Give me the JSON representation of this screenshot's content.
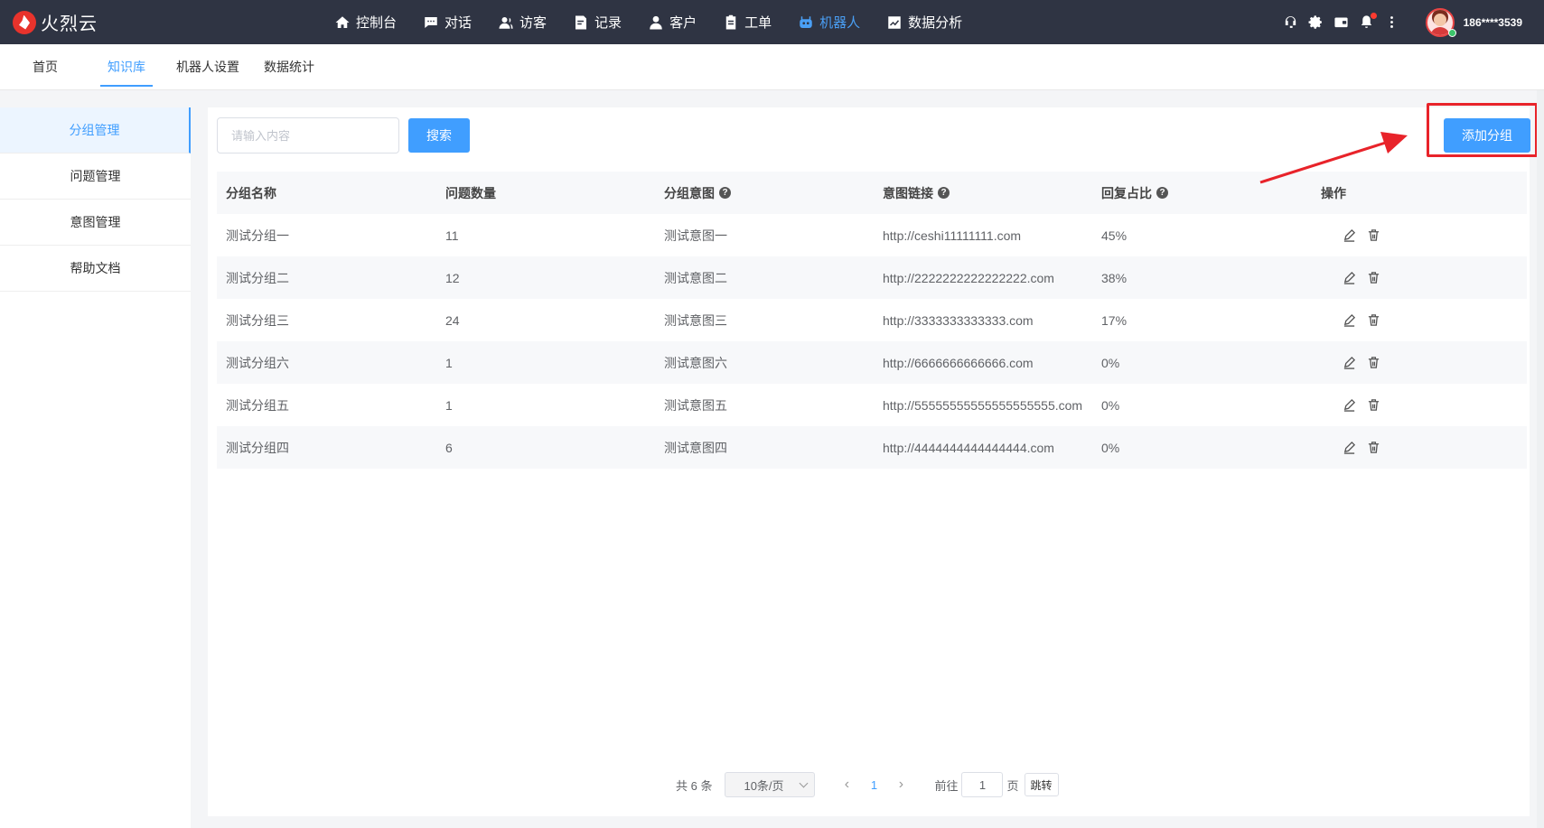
{
  "app": {
    "logo_text": "火烈云",
    "brand_color": "#e8332c",
    "accent_color": "#409eff",
    "topbar_color": "#2f3443"
  },
  "nav": {
    "items": [
      {
        "label": "控制台",
        "icon": "home-icon"
      },
      {
        "label": "对话",
        "icon": "chat-icon"
      },
      {
        "label": "访客",
        "icon": "visitor-icon"
      },
      {
        "label": "记录",
        "icon": "record-icon"
      },
      {
        "label": "客户",
        "icon": "customer-icon"
      },
      {
        "label": "工单",
        "icon": "ticket-icon"
      },
      {
        "label": "机器人",
        "icon": "robot-icon",
        "active": true
      },
      {
        "label": "数据分析",
        "icon": "chart-icon"
      }
    ]
  },
  "user": {
    "name": "186****3539",
    "status": "online"
  },
  "subtabs": [
    {
      "label": "首页"
    },
    {
      "label": "知识库",
      "active": true
    },
    {
      "label": "机器人设置"
    },
    {
      "label": "数据统计"
    }
  ],
  "sidebar": {
    "items": [
      {
        "label": "分组管理",
        "active": true
      },
      {
        "label": "问题管理"
      },
      {
        "label": "意图管理"
      },
      {
        "label": "帮助文档"
      }
    ]
  },
  "toolbar": {
    "search_placeholder": "请输入内容",
    "search_label": "搜索",
    "add_label": "添加分组"
  },
  "table": {
    "headers": [
      "分组名称",
      "问题数量",
      "分组意图",
      "意图链接",
      "回复占比",
      "操作"
    ],
    "rows": [
      [
        "测试分组一",
        "11",
        "测试意图一",
        "http://ceshi11111111.com",
        "45%"
      ],
      [
        "测试分组二",
        "12",
        "测试意图二",
        "http://2222222222222222.com",
        "38%"
      ],
      [
        "测试分组三",
        "24",
        "测试意图三",
        "http://3333333333333.com",
        "17%"
      ],
      [
        "测试分组六",
        "1",
        "测试意图六",
        "http://6666666666666.com",
        "0%"
      ],
      [
        "测试分组五",
        "1",
        "测试意图五",
        "http://55555555555555555555.com",
        "0%"
      ],
      [
        "测试分组四",
        "6",
        "测试意图四",
        "http://4444444444444444.com",
        "0%"
      ]
    ]
  },
  "pagination": {
    "total": "共 6 条",
    "page_size": "10条/页",
    "current_page": "1",
    "prev": "‹",
    "next": "›",
    "goto_label": "前往",
    "goto_value": "1",
    "page_unit": "页",
    "jump_label": "跳转"
  }
}
